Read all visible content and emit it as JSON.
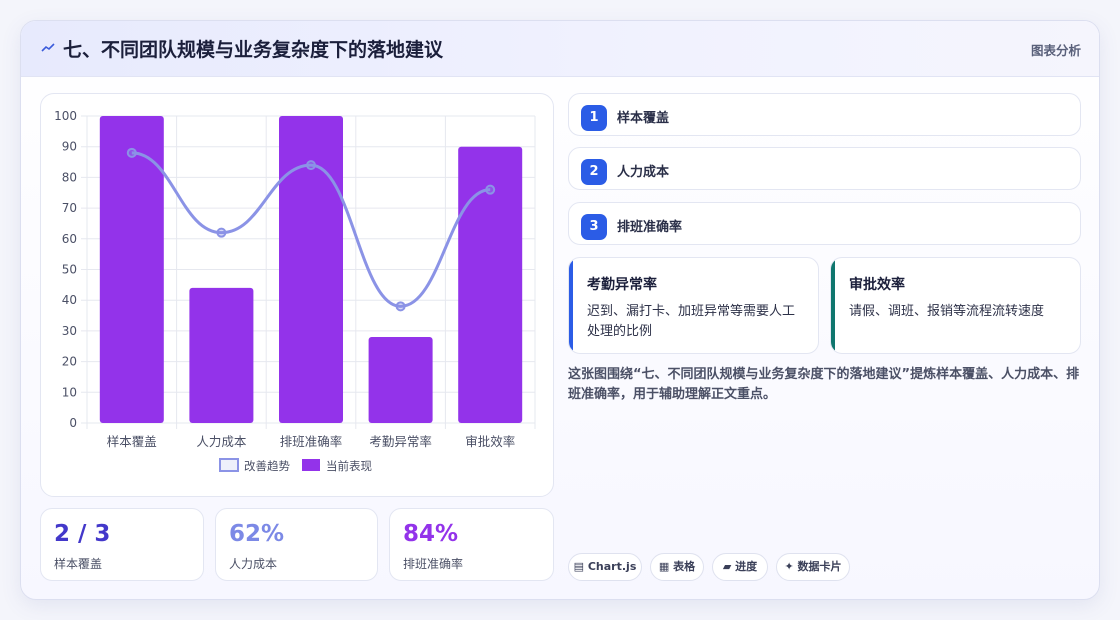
{
  "header": {
    "title": "七、不同团队规模与业务复杂度下的落地建议",
    "tag": "图表分析",
    "icon": "trend-icon"
  },
  "chart_data": {
    "type": "bar",
    "categories": [
      "样本覆盖",
      "人力成本",
      "排班准确率",
      "考勤异常率",
      "审批效率"
    ],
    "series": [
      {
        "name": "当前表现",
        "type": "bar",
        "values": [
          100,
          44,
          100,
          28,
          90
        ],
        "color": "#9333ea"
      },
      {
        "name": "改善趋势",
        "type": "line",
        "values": [
          88,
          62,
          84,
          38,
          76
        ],
        "color": "#8b93e6"
      }
    ],
    "ylim": [
      0,
      100
    ],
    "yticks": [
      "0",
      "10",
      "20",
      "30",
      "40",
      "50",
      "60",
      "70",
      "80",
      "90",
      "100"
    ],
    "legend": [
      "改善趋势",
      "当前表现"
    ],
    "legend_position": "bottom",
    "grid": true
  },
  "kpis": [
    {
      "value": "2 / 3",
      "label": "样本覆盖",
      "color": "#4338ca"
    },
    {
      "value": "62%",
      "label": "人力成本",
      "color": "#7c89e6"
    },
    {
      "value": "84%",
      "label": "排班准确率",
      "color": "#9333ea"
    }
  ],
  "steps": [
    {
      "num": "1",
      "label": "样本覆盖"
    },
    {
      "num": "2",
      "label": "人力成本"
    },
    {
      "num": "3",
      "label": "排班准确率"
    }
  ],
  "info_cards": [
    {
      "title": "考勤异常率",
      "desc": "迟到、漏打卡、加班异常等需要人工处理的比例",
      "color": "#2b5ce6"
    },
    {
      "title": "审批效率",
      "desc": "请假、调班、报销等流程流转速度",
      "color": "#0f766e"
    }
  ],
  "summary": "这张图围绕“七、不同团队规模与业务复杂度下的落地建议”提炼样本覆盖、人力成本、排班准确率，用于辅助理解正文重点。",
  "chips": [
    {
      "icon": "chart-icon",
      "label": "Chart.js"
    },
    {
      "icon": "table-icon",
      "label": "表格"
    },
    {
      "icon": "progress-icon",
      "label": "进度"
    },
    {
      "icon": "sparkle-icon",
      "label": "数据卡片"
    }
  ]
}
